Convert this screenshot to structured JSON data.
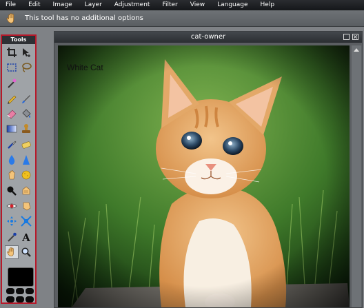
{
  "menu": [
    "File",
    "Edit",
    "Image",
    "Layer",
    "Adjustment",
    "Filter",
    "View",
    "Language",
    "Help"
  ],
  "options_bar": {
    "message": "This tool has no additional options",
    "tool_icon": "hand-icon"
  },
  "tools_panel": {
    "title": "Tools",
    "tools": [
      {
        "name": "crop-icon"
      },
      {
        "name": "move-icon"
      },
      {
        "name": "marquee-select-icon"
      },
      {
        "name": "lasso-icon"
      },
      {
        "name": "magic-wand-icon"
      },
      {
        "name": ""
      },
      {
        "name": "pencil-icon"
      },
      {
        "name": "brush-icon"
      },
      {
        "name": "eraser-icon"
      },
      {
        "name": "paint-bucket-icon"
      },
      {
        "name": "gradient-icon"
      },
      {
        "name": "clone-stamp-icon"
      },
      {
        "name": "color-replace-icon"
      },
      {
        "name": "healing-icon"
      },
      {
        "name": "blur-drop-icon"
      },
      {
        "name": "sharpen-icon"
      },
      {
        "name": "smudge-icon"
      },
      {
        "name": "sponge-icon"
      },
      {
        "name": "dodge-icon"
      },
      {
        "name": "burn-icon"
      },
      {
        "name": "red-eye-icon"
      },
      {
        "name": "spot-heal-icon"
      },
      {
        "name": "bloat-icon"
      },
      {
        "name": "pinch-icon"
      },
      {
        "name": "color-picker-icon"
      },
      {
        "name": "type-icon"
      },
      {
        "name": "hand-icon",
        "selected": true
      },
      {
        "name": "zoom-icon"
      }
    ]
  },
  "document": {
    "title": "cat-owner",
    "layer_text": "White Cat"
  },
  "colors": {
    "accent_border": "#b7192a",
    "menubar": "#15171a",
    "panel": "#9fa3a7"
  }
}
